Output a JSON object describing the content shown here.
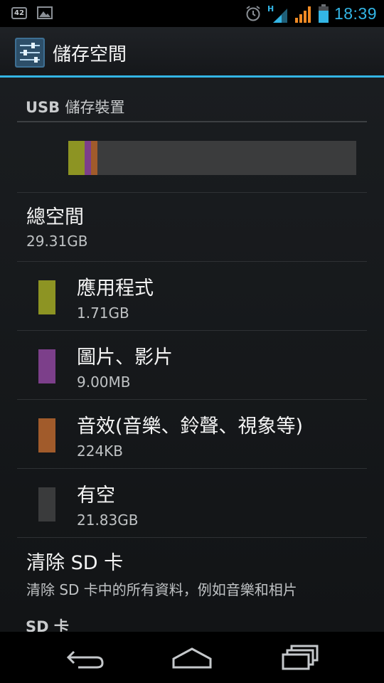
{
  "status_bar": {
    "notification_count": "42",
    "icons": [
      "notification-badge-icon",
      "gallery-icon",
      "alarm-icon",
      "hspa-signal-icon",
      "signal-bars-icon",
      "battery-icon"
    ],
    "network_type": "H",
    "time": "18:39",
    "accent_color": "#33b5e5"
  },
  "action_bar": {
    "icon": "settings-sliders-icon",
    "title": "儲存空間"
  },
  "storage": {
    "section_header_prefix": "USB",
    "section_header": "儲存裝置",
    "usage_bar": [
      {
        "name": "apps",
        "color": "#8d9423",
        "fraction": 0.058
      },
      {
        "name": "pictures",
        "color": "#7c3f8a",
        "fraction": 0.022
      },
      {
        "name": "audio",
        "color": "#a15b2b",
        "fraction": 0.022
      },
      {
        "name": "available",
        "color": "#3b3c3d",
        "fraction": 0.898
      }
    ],
    "total_title": "總空間",
    "total_value": "29.31GB",
    "categories": [
      {
        "label": "應用程式",
        "value": "1.71GB",
        "color": "#8d9423"
      },
      {
        "label": "圖片、影片",
        "value": "9.00MB",
        "color": "#7c3f8a"
      },
      {
        "label": "音效(音樂、鈴聲、視象等)",
        "value": "224KB",
        "color": "#a15b2b"
      },
      {
        "label": "有空",
        "value": "21.83GB",
        "color": "#3a3b3c"
      }
    ],
    "erase": {
      "title": "清除 SD 卡",
      "subtitle": "清除 SD 卡中的所有資料，例如音樂和相片"
    },
    "next_section_header": "SD 卡"
  },
  "nav_bar": {
    "back": "back-icon",
    "home": "home-icon",
    "recents": "recent-apps-icon"
  }
}
